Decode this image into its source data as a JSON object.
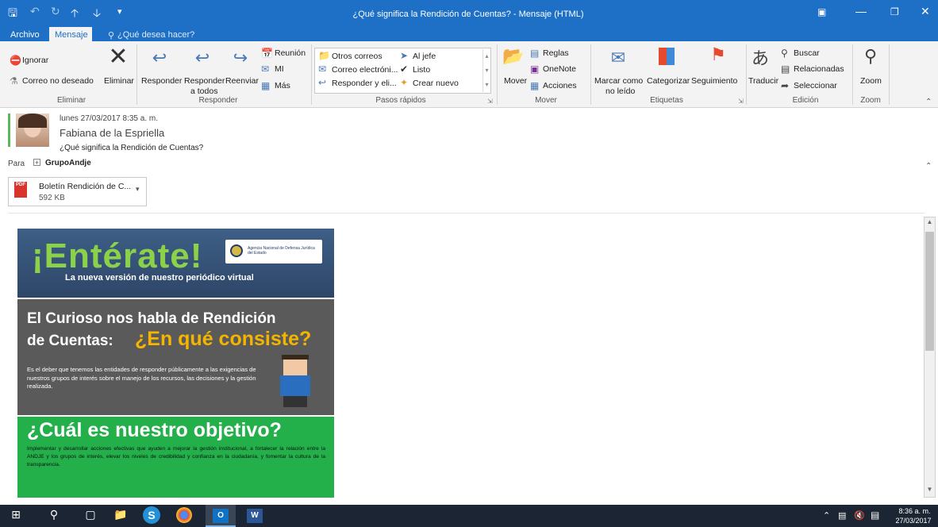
{
  "window": {
    "title": "¿Qué significa la Rendición de Cuentas?  -  Mensaje (HTML)",
    "tabs": [
      "Archivo",
      "Mensaje"
    ],
    "tell_me": "¿Qué desea hacer?"
  },
  "ribbon": {
    "eliminar": {
      "ignorar": "Ignorar",
      "correo_no_deseado": "Correo no deseado",
      "eliminar": "Eliminar",
      "label": "Eliminar"
    },
    "responder": {
      "responder": "Responder",
      "responder_todos_1": "Responder",
      "responder_todos_2": "a todos",
      "reenviar": "Reenviar",
      "reunion": "Reunión",
      "mi": "MI",
      "mas": "Más",
      "label": "Responder"
    },
    "pasos": {
      "otros_correos": "Otros correos",
      "al_jefe": "Al jefe",
      "correo_electronico": "Correo electróni...",
      "listo": "Listo",
      "responder_eli": "Responder y eli...",
      "crear_nuevo": "Crear nuevo",
      "label": "Pasos rápidos"
    },
    "mover": {
      "mover": "Mover",
      "reglas": "Reglas",
      "onenote": "OneNote",
      "acciones": "Acciones",
      "label": "Mover"
    },
    "etiquetas": {
      "marcar_1": "Marcar como",
      "marcar_2": "no leído",
      "categorizar": "Categorizar",
      "seguimiento": "Seguimiento",
      "label": "Etiquetas"
    },
    "edicion": {
      "traducir": "Traducir",
      "buscar": "Buscar",
      "relacionadas": "Relacionadas",
      "seleccionar": "Seleccionar",
      "label": "Edición"
    },
    "zoom": {
      "zoom": "Zoom",
      "label": "Zoom"
    }
  },
  "message": {
    "date": "lunes 27/03/2017 8:35 a. m.",
    "sender": "Fabiana de la Espriella",
    "subject": "¿Qué significa la Rendición de Cuentas?",
    "to_label": "Para",
    "to": "GrupoAndje",
    "attachment": {
      "name": "Boletín Rendición de C...",
      "size": "592 KB",
      "type": "PDF"
    }
  },
  "newsletter": {
    "headline": "¡Entérate!",
    "subheadline": "La nueva versión de nuestro periódico virtual",
    "logo_text": "Agencia Nacional de Defensa Jurídica del Estado",
    "section2_title_1": "El Curioso nos habla de Rendición",
    "section2_title_2": "de Cuentas:",
    "section2_highlight": "¿En qué consiste?",
    "section2_body": "Es el deber que tenemos las entidades de responder públicamente a las exigencias de nuestros grupos de interés sobre el manejo de los recursos, las decisiones  y la gestión realizada.",
    "section3_title": "¿Cuál es nuestro objetivo?",
    "section3_body": "Implementar y desarrollar acciones efectivas que ayuden a mejorar la gestión institucional, a fortalecer la relación entre la ANDJE y los grupos de interés, elevar los niveles de credibilidad y confianza en la ciudadanía, y fomentar la cultura de la transparencia."
  },
  "taskbar": {
    "time": "8:36 a. m.",
    "date": "27/03/2017"
  },
  "colors": {
    "titlebar": "#1e6fc6",
    "taskbar": "#1c2533",
    "green": "#23b04b",
    "orange": "#f4b400"
  }
}
